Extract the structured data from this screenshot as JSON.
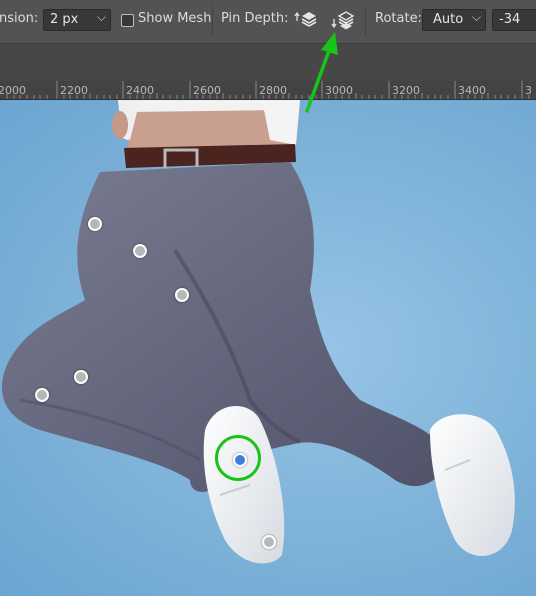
{
  "options_bar": {
    "expansion_label": "nsion:",
    "expansion_value": "2 px",
    "show_mesh_label": "Show Mesh",
    "show_mesh_checked": false,
    "pin_depth_label": "Pin Depth:",
    "rotate_label": "Rotate:",
    "rotate_value": "Auto",
    "angle_value": "-34"
  },
  "ruler": {
    "labels": [
      "2000",
      "2200",
      "2400",
      "2600",
      "2800",
      "3000",
      "3200",
      "3400",
      "3"
    ]
  },
  "colors": {
    "annotation_arrow": "#19c417",
    "selected_pin": "#3d7fe0",
    "background": "#7fb3d9"
  }
}
